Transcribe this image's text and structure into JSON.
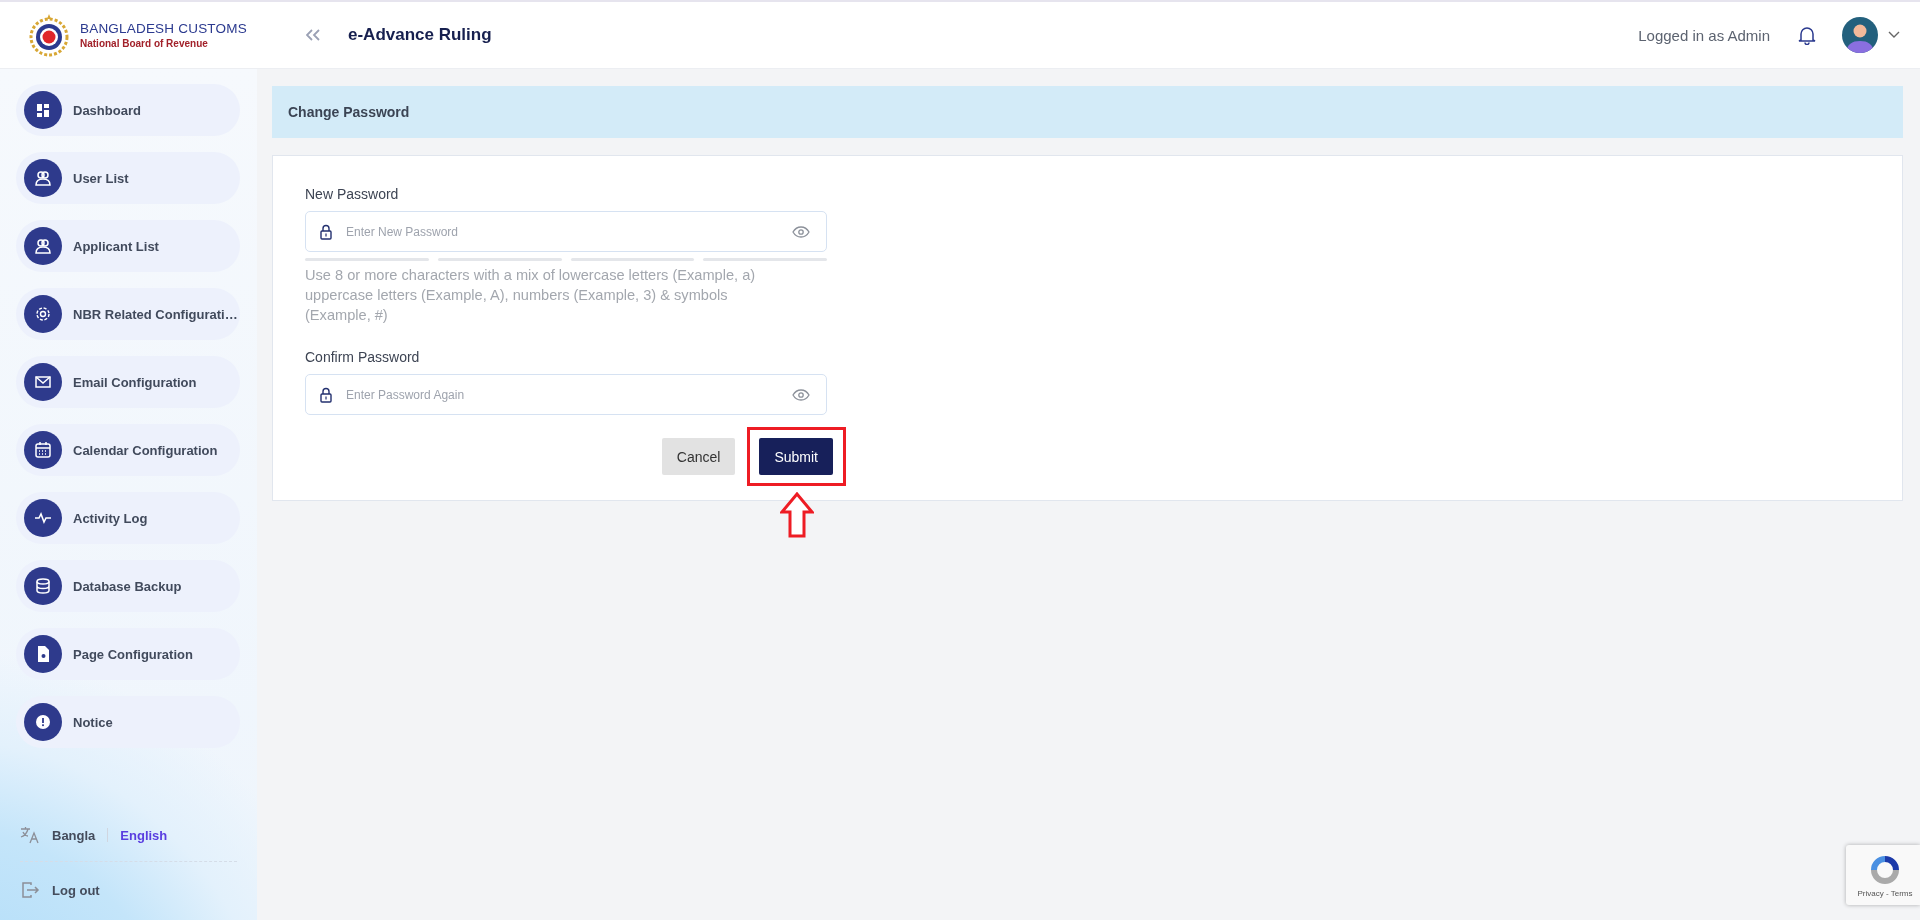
{
  "header": {
    "logo_title": "BANGLADESH CUSTOMS",
    "logo_subtitle": "National Board of Revenue",
    "app_title": "e-Advance Ruling",
    "user_status": "Logged in as Admin"
  },
  "sidebar": {
    "items": [
      {
        "label": "Dashboard"
      },
      {
        "label": "User List"
      },
      {
        "label": "Applicant List"
      },
      {
        "label": "NBR Related Configurati…"
      },
      {
        "label": "Email Configuration"
      },
      {
        "label": "Calendar Configuration"
      },
      {
        "label": "Activity Log"
      },
      {
        "label": "Database Backup"
      },
      {
        "label": "Page Configuration"
      },
      {
        "label": "Notice"
      }
    ],
    "languages": [
      {
        "label": "Bangla",
        "selected": false
      },
      {
        "label": "English",
        "selected": true
      }
    ],
    "logout": "Log out"
  },
  "page": {
    "title": "Change Password",
    "fields": [
      {
        "label": "New Password",
        "placeholder": "Enter New Password",
        "hint": "Use 8 or more characters with a mix of lowercase letters (Example, a) uppercase letters (Example, A), numbers (Example, 3) & symbols (Example, #)"
      },
      {
        "label": "Confirm Password",
        "placeholder": "Enter Password Again"
      }
    ],
    "buttons": [
      {
        "label": "Cancel",
        "kind": "secondary",
        "highlighted": false
      },
      {
        "label": "Submit",
        "kind": "primary",
        "highlighted": true
      }
    ]
  },
  "recaptcha": {
    "links": "Privacy - Terms"
  }
}
